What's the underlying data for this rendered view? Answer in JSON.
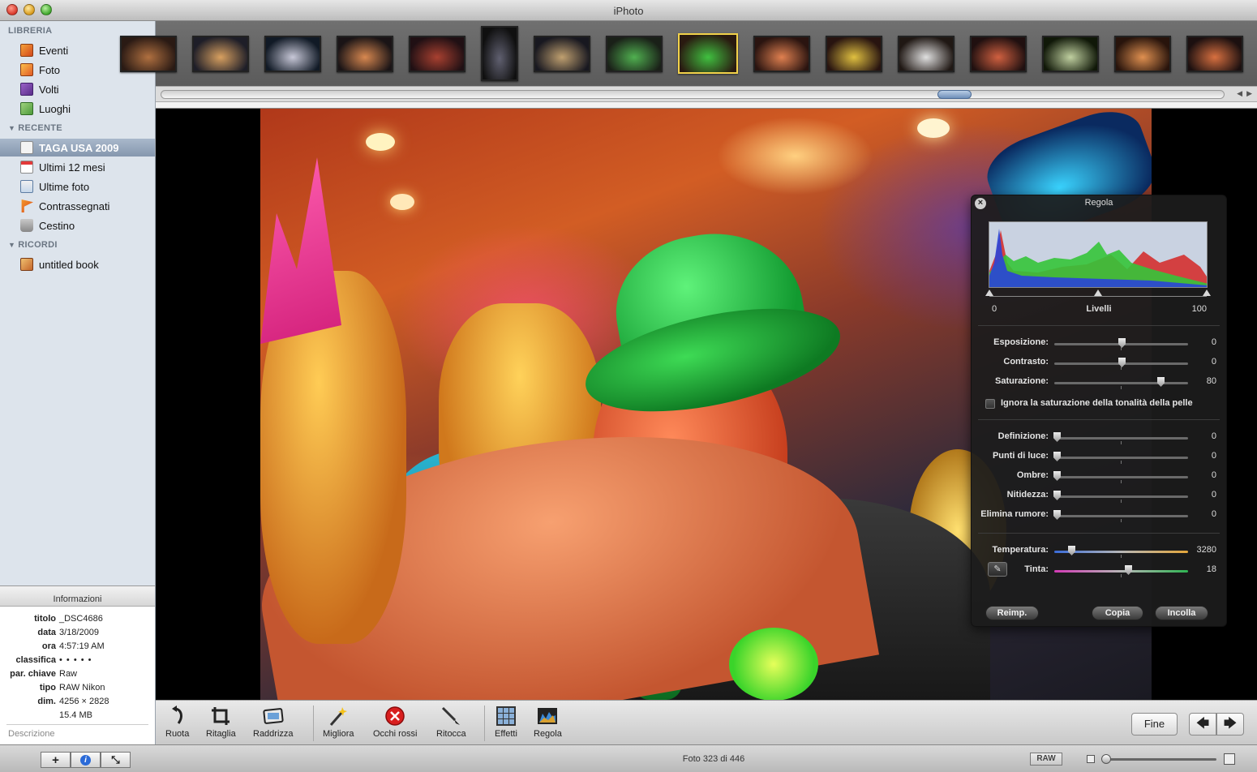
{
  "window": {
    "title": "iPhoto"
  },
  "sidebar": {
    "sections": [
      {
        "label": "LIBRERIA",
        "items": [
          {
            "label": "Eventi",
            "icon": "events-icon"
          },
          {
            "label": "Foto",
            "icon": "photos-icon"
          },
          {
            "label": "Volti",
            "icon": "faces-icon"
          },
          {
            "label": "Luoghi",
            "icon": "places-icon"
          }
        ]
      },
      {
        "label": "RECENTE",
        "items": [
          {
            "label": "TAGA USA 2009",
            "icon": "album-icon",
            "selected": true
          },
          {
            "label": "Ultimi 12 mesi",
            "icon": "calendar-icon"
          },
          {
            "label": "Ultime foto",
            "icon": "import-icon"
          },
          {
            "label": "Contrassegnati",
            "icon": "flag-icon"
          },
          {
            "label": "Cestino",
            "icon": "trash-icon"
          }
        ]
      },
      {
        "label": "RICORDI",
        "items": [
          {
            "label": "untitled book",
            "icon": "book-icon"
          }
        ]
      }
    ]
  },
  "info": {
    "header": "Informazioni",
    "rows": [
      {
        "key": "titolo",
        "value": "_DSC4686"
      },
      {
        "key": "data",
        "value": "3/18/2009"
      },
      {
        "key": "ora",
        "value": "4:57:19 AM"
      },
      {
        "key": "classifica",
        "value": "• • • • •"
      },
      {
        "key": "par. chiave",
        "value": "Raw"
      },
      {
        "key": "tipo",
        "value": "RAW Nikon"
      },
      {
        "key": "dim.",
        "value": "4256 × 2828"
      },
      {
        "key": "",
        "value": "15.4 MB"
      }
    ],
    "description_placeholder": "Descrizione"
  },
  "bottombar": {
    "photo_count": "Foto 323 di 446",
    "raw_badge": "RAW",
    "add_symbol": "+",
    "info_symbol": "i",
    "fullscreen_symbol": "⤡"
  },
  "filmstrip": {
    "thumbnails": [
      {
        "colors": [
          "#2a1a14",
          "#b07040"
        ]
      },
      {
        "colors": [
          "#1e1e28",
          "#d8a060"
        ]
      },
      {
        "colors": [
          "#111a26",
          "#c8c8d8"
        ]
      },
      {
        "colors": [
          "#1a1416",
          "#d88850"
        ]
      },
      {
        "colors": [
          "#201014",
          "#a84030"
        ]
      },
      {
        "colors": [
          "#101010",
          "#606070"
        ],
        "tall": true
      },
      {
        "colors": [
          "#181820",
          "#c0a070"
        ]
      },
      {
        "colors": [
          "#1a2018",
          "#50b050"
        ]
      },
      {
        "colors": [
          "#2a1a10",
          "#40c040"
        ],
        "selected": true
      },
      {
        "colors": [
          "#2a1410",
          "#e08050"
        ]
      },
      {
        "colors": [
          "#281410",
          "#e0c040"
        ]
      },
      {
        "colors": [
          "#201814",
          "#e0e0e0"
        ]
      },
      {
        "colors": [
          "#201010",
          "#d06040"
        ]
      },
      {
        "colors": [
          "#101808",
          "#c0d0a0"
        ]
      },
      {
        "colors": [
          "#28140c",
          "#e09050"
        ]
      },
      {
        "colors": [
          "#1c1010",
          "#d87040"
        ]
      }
    ]
  },
  "adjust": {
    "title": "Regola",
    "levels": {
      "label": "Livelli",
      "min": "0",
      "max": "100"
    },
    "group1": [
      {
        "label": "Esposizione:",
        "value": "0",
        "position": 0.5
      },
      {
        "label": "Contrasto:",
        "value": "0",
        "position": 0.5
      },
      {
        "label": "Saturazione:",
        "value": "80",
        "position": 0.8
      }
    ],
    "skin_checkbox": "Ignora la saturazione della tonalità della pelle",
    "group2": [
      {
        "label": "Definizione:",
        "value": "0",
        "position": 0
      },
      {
        "label": "Punti di luce:",
        "value": "0",
        "position": 0
      },
      {
        "label": "Ombre:",
        "value": "0",
        "position": 0
      },
      {
        "label": "Nitidezza:",
        "value": "0",
        "position": 0
      },
      {
        "label": "Elimina rumore:",
        "value": "0",
        "position": 0
      }
    ],
    "group3": [
      {
        "label": "Temperatura:",
        "value": "3280",
        "position": 0.11,
        "style": "temp"
      },
      {
        "label": "Tinta:",
        "value": "18",
        "position": 0.55,
        "style": "tint"
      }
    ],
    "buttons": {
      "reset": "Reimp.",
      "copy": "Copia",
      "paste": "Incolla"
    }
  },
  "toolbar": {
    "tools": [
      {
        "label": "Ruota",
        "icon": "rotate-icon"
      },
      {
        "label": "Ritaglia",
        "icon": "crop-icon"
      },
      {
        "label": "Raddrizza",
        "icon": "straighten-icon"
      },
      {
        "label": "Migliora",
        "icon": "enhance-wand-icon"
      },
      {
        "label": "Occhi rossi",
        "icon": "red-eye-icon"
      },
      {
        "label": "Ritocca",
        "icon": "retouch-brush-icon"
      },
      {
        "label": "Effetti",
        "icon": "effects-grid-icon"
      },
      {
        "label": "Regola",
        "icon": "adjust-histogram-icon"
      }
    ],
    "done": "Fine",
    "prev_symbol": "🡄",
    "next_symbol": "🡆"
  }
}
